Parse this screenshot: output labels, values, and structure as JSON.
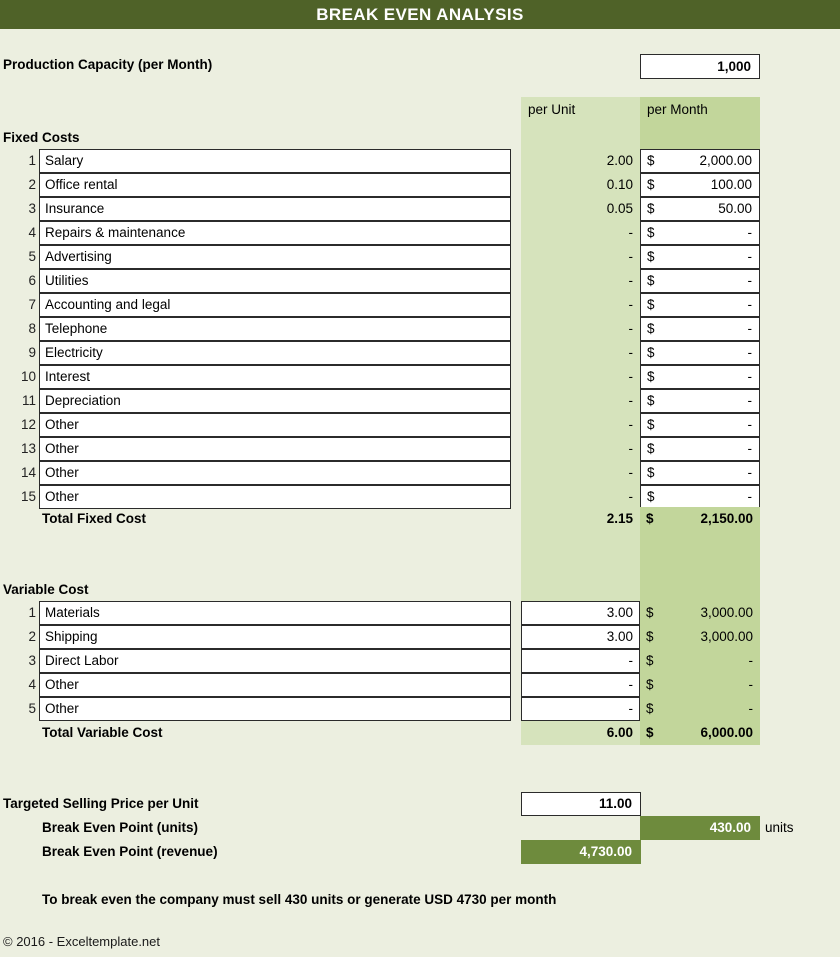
{
  "title": "BREAK EVEN ANALYSIS",
  "colors": {
    "title_bar": "#4F6228",
    "background": "#ECEFE0",
    "per_unit_band": "#D6E3BC",
    "per_month_band": "#C2D69B",
    "result_accent": "#6E8B3D"
  },
  "capacity": {
    "label": "Production Capacity (per Month)",
    "value": "1,000"
  },
  "columns": {
    "per_unit": "per Unit",
    "per_month": "per Month"
  },
  "fixed_costs": {
    "section_label": "Fixed Costs",
    "rows": [
      {
        "num": "1",
        "name": "Salary",
        "per_unit": "2.00",
        "currency": "$",
        "per_month": "2,000.00"
      },
      {
        "num": "2",
        "name": "Office rental",
        "per_unit": "0.10",
        "currency": "$",
        "per_month": "100.00"
      },
      {
        "num": "3",
        "name": "Insurance",
        "per_unit": "0.05",
        "currency": "$",
        "per_month": "50.00"
      },
      {
        "num": "4",
        "name": "Repairs & maintenance",
        "per_unit": "-",
        "currency": "$",
        "per_month": "-"
      },
      {
        "num": "5",
        "name": "Advertising",
        "per_unit": "-",
        "currency": "$",
        "per_month": "-"
      },
      {
        "num": "6",
        "name": "Utilities",
        "per_unit": "-",
        "currency": "$",
        "per_month": "-"
      },
      {
        "num": "7",
        "name": "Accounting and legal",
        "per_unit": "-",
        "currency": "$",
        "per_month": "-"
      },
      {
        "num": "8",
        "name": "Telephone",
        "per_unit": "-",
        "currency": "$",
        "per_month": "-"
      },
      {
        "num": "9",
        "name": "Electricity",
        "per_unit": "-",
        "currency": "$",
        "per_month": "-"
      },
      {
        "num": "10",
        "name": "Interest",
        "per_unit": "-",
        "currency": "$",
        "per_month": "-"
      },
      {
        "num": "11",
        "name": "Depreciation",
        "per_unit": "-",
        "currency": "$",
        "per_month": "-"
      },
      {
        "num": "12",
        "name": "Other",
        "per_unit": "-",
        "currency": "$",
        "per_month": "-"
      },
      {
        "num": "13",
        "name": "Other",
        "per_unit": "-",
        "currency": "$",
        "per_month": "-"
      },
      {
        "num": "14",
        "name": "Other",
        "per_unit": "-",
        "currency": "$",
        "per_month": "-"
      },
      {
        "num": "15",
        "name": "Other",
        "per_unit": "-",
        "currency": "$",
        "per_month": "-"
      }
    ],
    "total": {
      "label": "Total Fixed Cost",
      "per_unit": "2.15",
      "currency": "$",
      "per_month": "2,150.00"
    }
  },
  "variable_costs": {
    "section_label": "Variable Cost",
    "rows": [
      {
        "num": "1",
        "name": "Materials",
        "per_unit": "3.00",
        "currency": "$",
        "per_month": "3,000.00"
      },
      {
        "num": "2",
        "name": "Shipping",
        "per_unit": "3.00",
        "currency": "$",
        "per_month": "3,000.00"
      },
      {
        "num": "3",
        "name": "Direct Labor",
        "per_unit": "-",
        "currency": "$",
        "per_month": "-"
      },
      {
        "num": "4",
        "name": "Other",
        "per_unit": "-",
        "currency": "$",
        "per_month": "-"
      },
      {
        "num": "5",
        "name": "Other",
        "per_unit": "-",
        "currency": "$",
        "per_month": "-"
      }
    ],
    "total": {
      "label": "Total Variable Cost",
      "per_unit": "6.00",
      "currency": "$",
      "per_month": "6,000.00"
    }
  },
  "results": {
    "selling_price_label": "Targeted Selling Price per Unit",
    "selling_price_value": "11.00",
    "bep_units_label": "Break Even Point (units)",
    "bep_units_value": "430.00",
    "bep_units_suffix": "units",
    "bep_revenue_label": "Break Even Point (revenue)",
    "bep_revenue_value": "4,730.00",
    "summary": "To break even the company must sell 430 units or generate USD 4730 per month"
  },
  "footer": "© 2016 - Exceltemplate.net"
}
